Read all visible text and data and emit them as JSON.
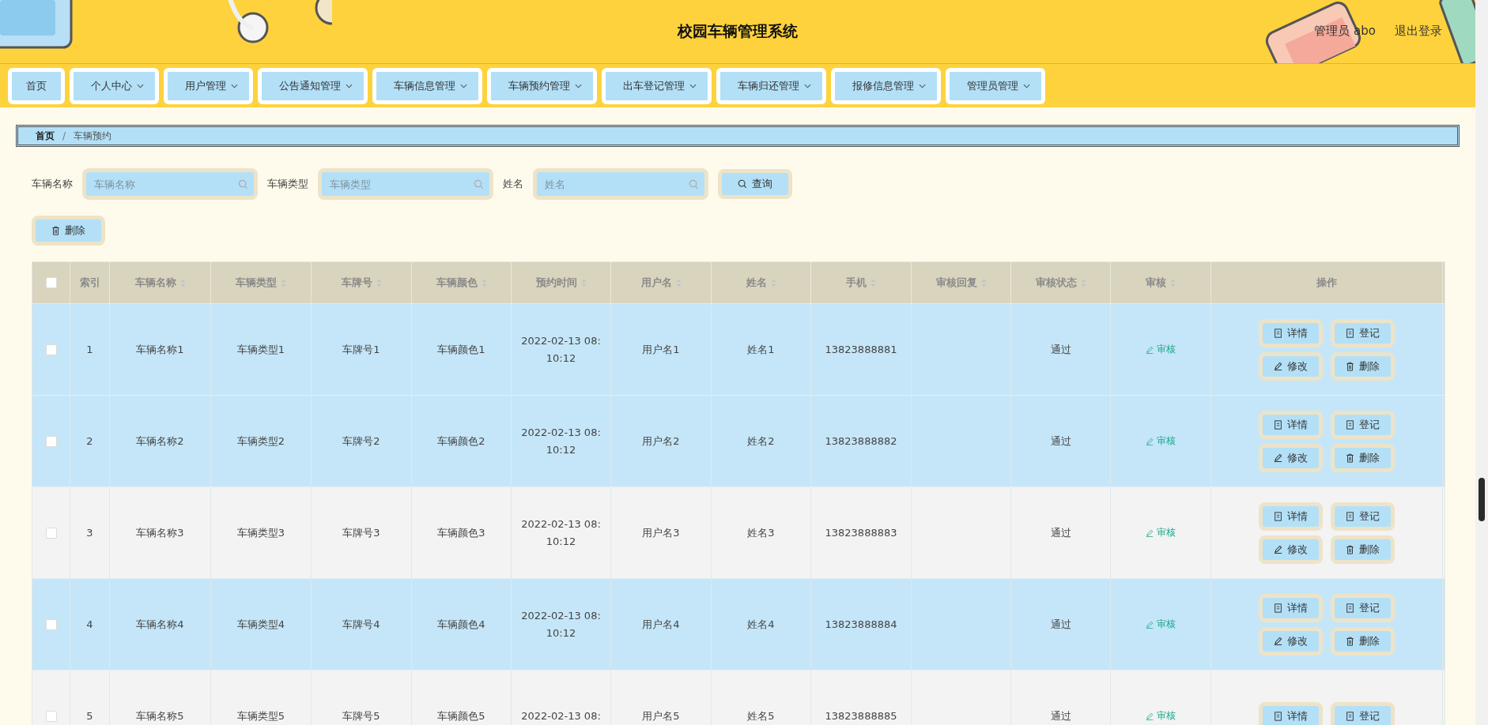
{
  "header": {
    "title": "校园车辆管理系统",
    "user": "管理员 abo",
    "logout": "退出登录"
  },
  "nav": [
    {
      "label": "首页",
      "dropdown": false
    },
    {
      "label": "个人中心",
      "dropdown": true
    },
    {
      "label": "用户管理",
      "dropdown": true
    },
    {
      "label": "公告通知管理",
      "dropdown": true
    },
    {
      "label": "车辆信息管理",
      "dropdown": true
    },
    {
      "label": "车辆预约管理",
      "dropdown": true
    },
    {
      "label": "出车登记管理",
      "dropdown": true
    },
    {
      "label": "车辆归还管理",
      "dropdown": true
    },
    {
      "label": "报修信息管理",
      "dropdown": true
    },
    {
      "label": "管理员管理",
      "dropdown": true
    }
  ],
  "breadcrumb": [
    "首页",
    "车辆预约"
  ],
  "breadcrumb_separator": "/",
  "filters": [
    {
      "label": "车辆名称",
      "placeholder": "车辆名称"
    },
    {
      "label": "车辆类型",
      "placeholder": "车辆类型"
    },
    {
      "label": "姓名",
      "placeholder": "姓名"
    }
  ],
  "search_button": "查询",
  "delete_button": "删除",
  "table": {
    "all_checked": false,
    "columns": [
      {
        "label": "索引",
        "sortable": false
      },
      {
        "label": "车辆名称",
        "sortable": true
      },
      {
        "label": "车辆类型",
        "sortable": true
      },
      {
        "label": "车牌号",
        "sortable": true
      },
      {
        "label": "车辆颜色",
        "sortable": true
      },
      {
        "label": "预约时间",
        "sortable": true
      },
      {
        "label": "用户名",
        "sortable": true
      },
      {
        "label": "姓名",
        "sortable": true
      },
      {
        "label": "手机",
        "sortable": true
      },
      {
        "label": "审核回复",
        "sortable": true
      },
      {
        "label": "审核状态",
        "sortable": true
      },
      {
        "label": "审核",
        "sortable": true
      },
      {
        "label": "操作",
        "sortable": false
      }
    ],
    "rows": [
      {
        "highlighted": true,
        "checked": false,
        "cells": [
          "1",
          "车辆名称1",
          "车辆类型1",
          "车牌号1",
          "车辆颜色1",
          "2022-02-13 08:\n10:12",
          "用户名1",
          "姓名1",
          "13823888881",
          "",
          "通过"
        ],
        "review": "审核",
        "actions": [
          {
            "label": "详情",
            "kind": "doc"
          },
          {
            "label": "登记",
            "kind": "doc"
          },
          {
            "label": "修改",
            "kind": "edit"
          },
          {
            "label": "删除",
            "kind": "trash"
          }
        ]
      },
      {
        "highlighted": true,
        "checked": false,
        "cells": [
          "2",
          "车辆名称2",
          "车辆类型2",
          "车牌号2",
          "车辆颜色2",
          "2022-02-13 08:\n10:12",
          "用户名2",
          "姓名2",
          "13823888882",
          "",
          "通过"
        ],
        "review": "审核",
        "actions": [
          {
            "label": "详情",
            "kind": "doc"
          },
          {
            "label": "登记",
            "kind": "doc"
          },
          {
            "label": "修改",
            "kind": "edit"
          },
          {
            "label": "删除",
            "kind": "trash"
          }
        ]
      },
      {
        "highlighted": false,
        "checked": false,
        "cells": [
          "3",
          "车辆名称3",
          "车辆类型3",
          "车牌号3",
          "车辆颜色3",
          "2022-02-13 08:\n10:12",
          "用户名3",
          "姓名3",
          "13823888883",
          "",
          "通过"
        ],
        "review": "审核",
        "actions": [
          {
            "label": "详情",
            "kind": "doc"
          },
          {
            "label": "登记",
            "kind": "doc"
          },
          {
            "label": "修改",
            "kind": "edit"
          },
          {
            "label": "删除",
            "kind": "trash"
          }
        ]
      },
      {
        "highlighted": true,
        "checked": false,
        "cells": [
          "4",
          "车辆名称4",
          "车辆类型4",
          "车牌号4",
          "车辆颜色4",
          "2022-02-13 08:\n10:12",
          "用户名4",
          "姓名4",
          "13823888884",
          "",
          "通过"
        ],
        "review": "审核",
        "actions": [
          {
            "label": "详情",
            "kind": "doc"
          },
          {
            "label": "登记",
            "kind": "doc"
          },
          {
            "label": "修改",
            "kind": "edit"
          },
          {
            "label": "删除",
            "kind": "trash"
          }
        ]
      },
      {
        "highlighted": false,
        "checked": false,
        "cells": [
          "5",
          "车辆名称5",
          "车辆类型5",
          "车牌号5",
          "车辆颜色5",
          "2022-02-13 08:",
          "用户名5",
          "姓名5",
          "13823888885",
          "",
          "通过"
        ],
        "review": "审核",
        "actions": [
          {
            "label": "详情",
            "kind": "doc"
          },
          {
            "label": "登记",
            "kind": "doc"
          }
        ]
      }
    ]
  }
}
